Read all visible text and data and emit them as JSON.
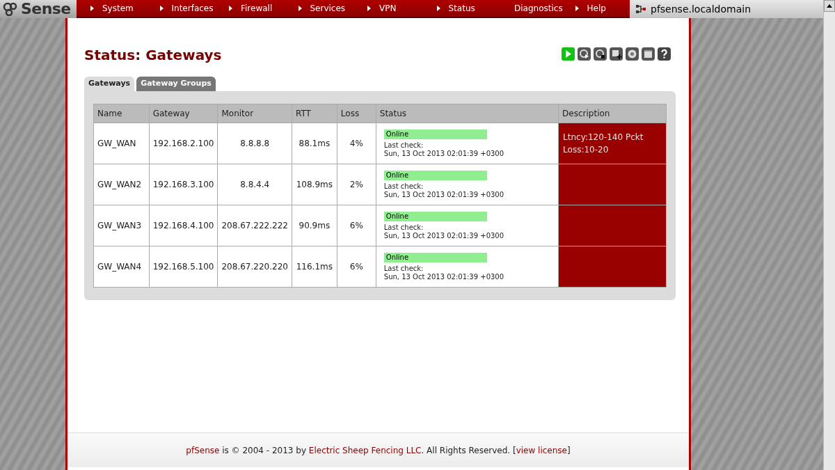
{
  "logo": {
    "text": "Sense"
  },
  "nav": [
    "System",
    "Interfaces",
    "Firewall",
    "Services",
    "VPN",
    "Status",
    "Diagnostics",
    "Help"
  ],
  "host": "pfsense.localdomain",
  "page_title": "Status: Gateways",
  "tabs": [
    {
      "label": "Gateways",
      "selected": true
    },
    {
      "label": "Gateway Groups",
      "selected": false
    }
  ],
  "table": {
    "columns": [
      "Name",
      "Gateway",
      "Monitor",
      "RTT",
      "Loss",
      "Status",
      "Description"
    ],
    "rows": [
      {
        "name": "GW_WAN",
        "gateway": "192.168.2.100",
        "monitor": "8.8.8.8",
        "rtt": "88.1ms",
        "loss": "4%",
        "status": {
          "kind": "online",
          "label": "Online",
          "check_label": "Last check:",
          "check_time": "Sun, 13 Oct 2013 02:01:39 +0300"
        },
        "description": [
          "Ltncy:120-140 Pckt",
          "Loss:10-20"
        ]
      },
      {
        "name": "GW_WAN2",
        "gateway": "192.168.3.100",
        "monitor": "8.8.4.4",
        "rtt": "108.9ms",
        "loss": "2%",
        "status": {
          "kind": "online",
          "label": "Online",
          "check_label": "Last check:",
          "check_time": "Sun, 13 Oct 2013 02:01:39 +0300"
        }
      },
      {
        "name": "GW_WAN3",
        "gateway": "192.168.4.100",
        "monitor": "208.67.222.222",
        "rtt": "90.9ms",
        "loss": "6%",
        "status": {
          "kind": "online",
          "label": "Online",
          "check_label": "Last check:",
          "check_time": "Sun, 13 Oct 2013 02:01:39 +0300"
        }
      },
      {
        "name": "GW_WAN4",
        "gateway": "192.168.5.100",
        "monitor": "208.67.220.220",
        "rtt": "116.1ms",
        "loss": "6%",
        "status": {
          "kind": "online",
          "label": "Online",
          "check_label": "Last check:",
          "check_time": "Sun, 13 Oct 2013 02:01:39 +0300"
        }
      }
    ]
  },
  "footer": [
    {
      "kind": "link",
      "text": "pfSense"
    },
    {
      "kind": "text",
      "text": " is © 2004 - 2013 by "
    },
    {
      "kind": "link",
      "text": "Electric Sheep Fencing LLC"
    },
    {
      "kind": "text",
      "text": ". All Rights Reserved. ["
    },
    {
      "kind": "link",
      "text": "view license"
    },
    {
      "kind": "text",
      "text": "]"
    }
  ]
}
